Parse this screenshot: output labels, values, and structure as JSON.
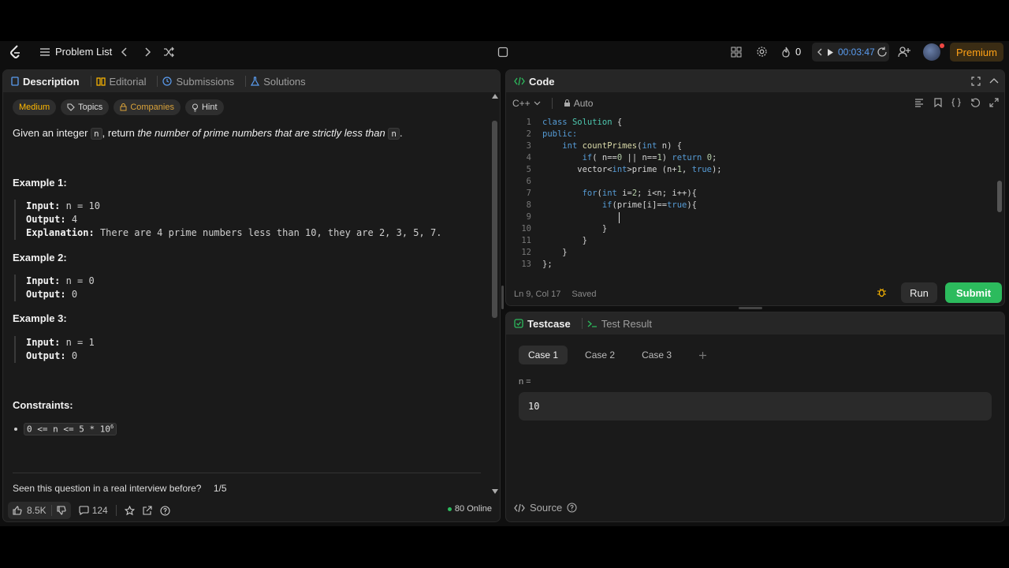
{
  "nav": {
    "problem_list": "Problem List",
    "streak": "0",
    "timer": "00:03:47",
    "premium": "Premium"
  },
  "left": {
    "tabs": [
      "Description",
      "Editorial",
      "Submissions",
      "Solutions"
    ],
    "tags": [
      "Medium",
      "Topics",
      "Companies",
      "Hint"
    ],
    "desc_pre": "Given an integer ",
    "desc_var": "n",
    "desc_mid": ", return ",
    "desc_em": "the number of prime numbers that are strictly less than ",
    "desc_end": ".",
    "examples": [
      {
        "title": "Example 1:",
        "input_label": "Input:",
        "input": "n = 10",
        "output_label": "Output:",
        "output": "4",
        "expl_label": "Explanation:",
        "expl": "There are 4 prime numbers less than 10, they are 2, 3, 5, 7."
      },
      {
        "title": "Example 2:",
        "input_label": "Input:",
        "input": "n = 0",
        "output_label": "Output:",
        "output": "0"
      },
      {
        "title": "Example 3:",
        "input_label": "Input:",
        "input": "n = 1",
        "output_label": "Output:",
        "output": "0"
      }
    ],
    "constraints_title": "Constraints:",
    "constraint": "0 <= n <= 5 * 10",
    "constraint_exp": "6",
    "seen": "Seen this question in a real interview before?",
    "seen_count": "1/5",
    "likes": "8.5K",
    "comments": "124",
    "online": "80 Online"
  },
  "code": {
    "title": "Code",
    "language": "C++",
    "auto": "Auto",
    "status_pos": "Ln 9, Col 17",
    "status_saved": "Saved",
    "run": "Run",
    "submit": "Submit",
    "lines": [
      "class Solution {",
      "public:",
      "    int countPrimes(int n) {",
      "        if( n==0 || n==1) return 0;",
      "       vector<int>prime (n+1, true);",
      "",
      "        for(int i=2; i<n; i++){",
      "            if(prime[i]==true){",
      "",
      "            }",
      "        }",
      "    }",
      "};"
    ]
  },
  "test": {
    "tabs": [
      "Testcase",
      "Test Result"
    ],
    "cases": [
      "Case 1",
      "Case 2",
      "Case 3"
    ],
    "param_label": "n =",
    "param_value": "10",
    "source": "Source"
  },
  "colors": {
    "accent_green": "#2cbb5d",
    "medium": "#ffb800",
    "premium": "#ffa116",
    "timer": "#5a9cf0"
  }
}
